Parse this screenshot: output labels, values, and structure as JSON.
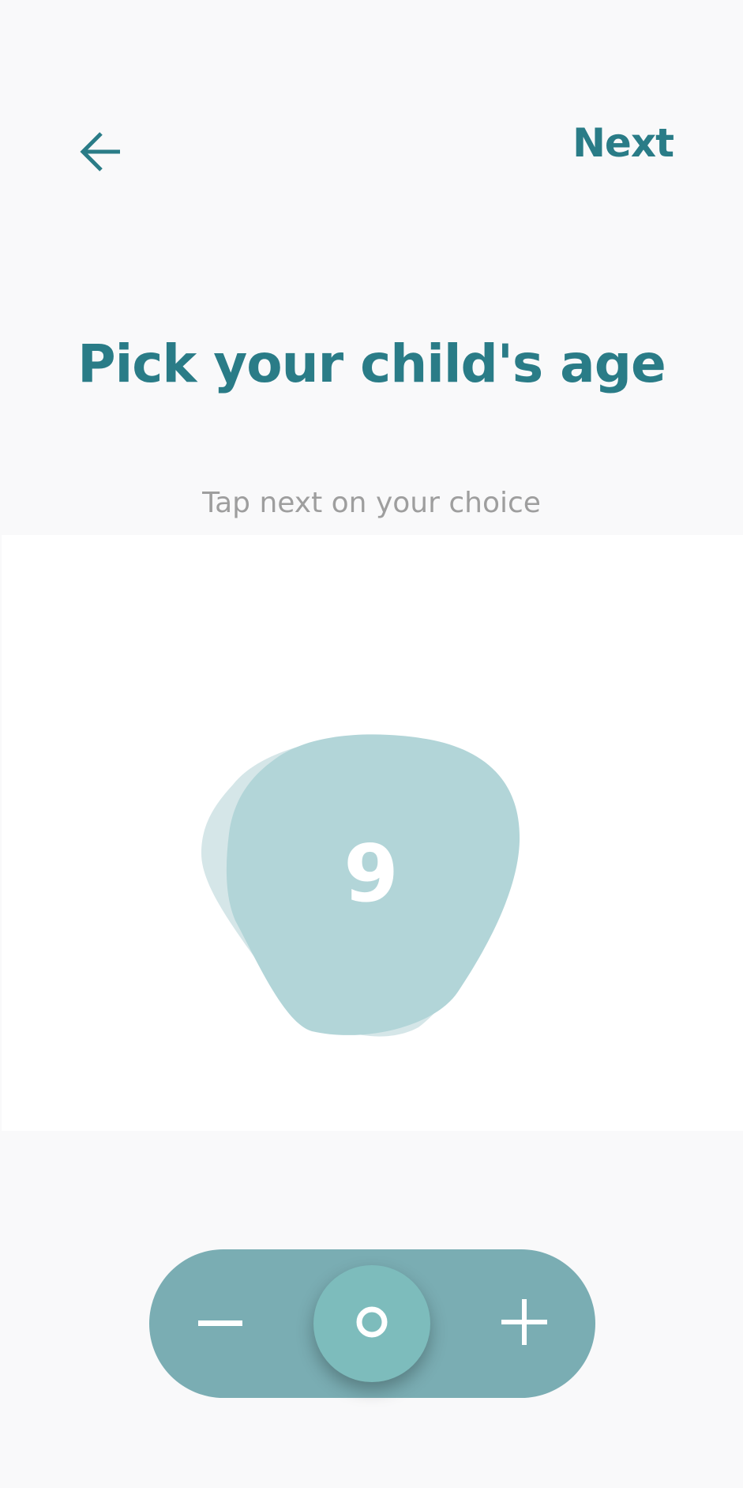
{
  "header": {
    "back_icon": "arrow-left-icon",
    "next_label": "Next"
  },
  "content": {
    "title": "Pick your child's age",
    "subtitle": "Tap next on your choice"
  },
  "picker": {
    "selected_age": "9",
    "blob_color": "#b2d5d8",
    "blob_back_color": "#d5e6e8"
  },
  "stepper": {
    "minus_icon": "minus-icon",
    "plus_icon": "plus-icon",
    "knob_icon": "ring-icon",
    "track_color": "#7aadb3",
    "knob_color": "#7dbcbc"
  },
  "colors": {
    "accent": "#2a7c87",
    "subtitle": "#9e9e9e",
    "background": "#f9f9fa",
    "panel": "#ffffff"
  }
}
